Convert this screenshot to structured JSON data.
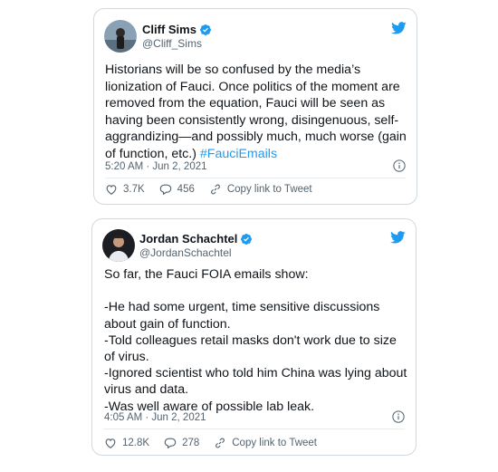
{
  "tweets": [
    {
      "name": "Cliff Sims",
      "handle": "@Cliff_Sims",
      "text": "Historians will be so confused by the media’s lionization of Fauci. Once politics of the moment are removed from the equation, Fauci will be seen as having been consistently wrong, disingenuous, self-aggrandizing—and possibly much, much worse (gain of function, etc.) ",
      "hashtag": "#FauciEmails",
      "timestamp": "5:20 AM · Jun 2, 2021",
      "likes": "3.7K",
      "replies": "456",
      "copy_link": "Copy link to Tweet"
    },
    {
      "name": "Jordan Schachtel",
      "handle": "@JordanSchachtel",
      "text": "So far, the Fauci FOIA emails show:\n\n-He had some urgent, time sensitive discussions about gain of function.\n-Told colleagues retail masks don't work due to size of virus.\n-Ignored scientist who told him China was lying about virus and data.\n-Was well aware of possible lab leak.",
      "timestamp": "4:05 AM · Jun 2, 2021",
      "likes": "12.8K",
      "replies": "278",
      "copy_link": "Copy link to Tweet"
    }
  ],
  "colors": {
    "accent": "#1d9bf0",
    "text": "#0f1419",
    "muted": "#536471",
    "border": "#cfd9de"
  },
  "icons": {
    "verified": "verified-badge-icon",
    "brand": "twitter-bird-icon",
    "info": "info-icon",
    "like": "heart-icon",
    "reply": "reply-bubble-icon",
    "link": "link-icon"
  }
}
